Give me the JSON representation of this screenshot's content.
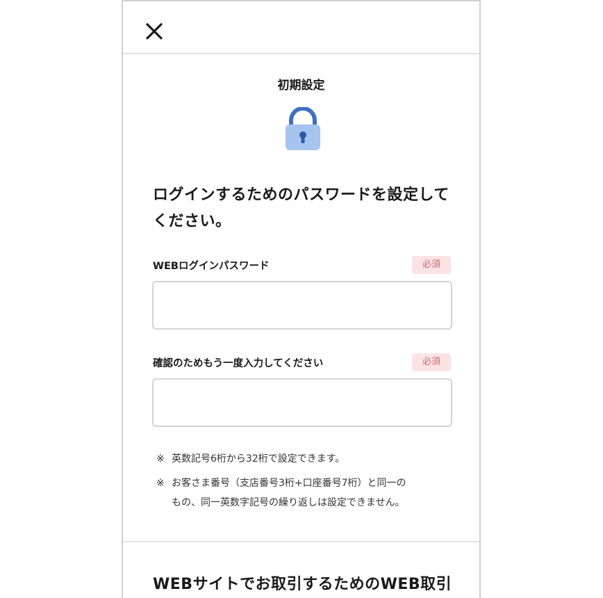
{
  "header": {
    "close_label": "close"
  },
  "page": {
    "title": "初期設定",
    "heading_line1": "ログインするためのパスワードを設定して",
    "heading_line2": "ください。"
  },
  "fields": [
    {
      "label": "WEBログインパスワード",
      "badge": "必須",
      "value": "",
      "placeholder": ""
    },
    {
      "label": "確認のためもう一度入力してください",
      "badge": "必須",
      "value": "",
      "placeholder": ""
    }
  ],
  "notes": {
    "mark": "※",
    "note1": "英数記号6桁から32桁で設定できます。",
    "note2_line1": "お客さま番号（支店番号3桁+口座番号7桁）と同一の",
    "note2_line2": "もの、同一英数字記号の繰り返しは設定できません。"
  },
  "next_section": {
    "heading": "WEBサイトでお取引するためのWEB取引"
  },
  "colors": {
    "lock_body": "#a7c4ef",
    "lock_shackle": "#3f6fbf",
    "badge_bg": "#fbe3e4",
    "badge_text": "#d9646c"
  },
  "icons": {
    "close": "close-icon",
    "lock": "lock-icon"
  }
}
